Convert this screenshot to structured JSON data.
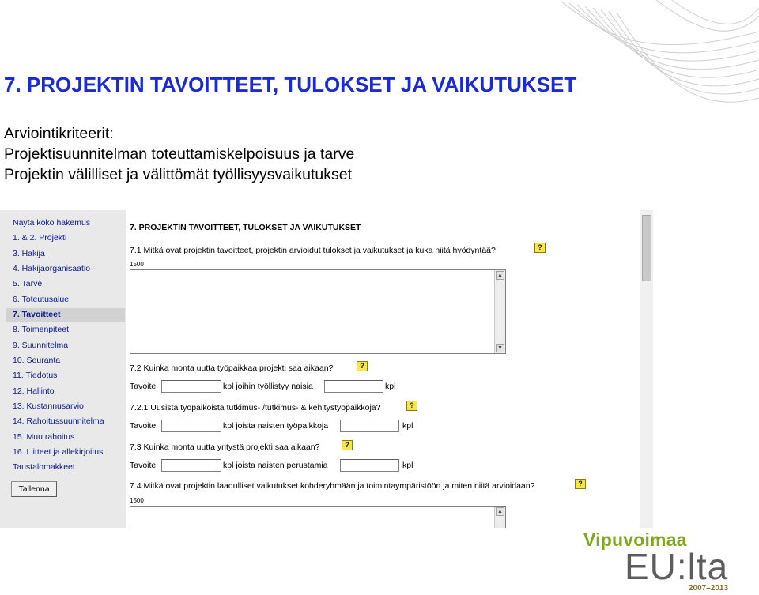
{
  "slide": {
    "title": "7. PROJEKTIN TAVOITTEET, TULOKSET JA VAIKUTUKSET",
    "criteria_heading": "Arviointikriteerit:",
    "criteria": [
      "Projektisuunnitelman toteuttamiskelpoisuus ja tarve",
      "Projektin välilliset ja välittömät työllisyysvaikutukset"
    ]
  },
  "sidebar": {
    "items": [
      "Näytä koko hakemus",
      "1. & 2. Projekti",
      "3. Hakija",
      "4. Hakijaorganisaatio",
      "5. Tarve",
      "6. Toteutusalue",
      "7. Tavoitteet",
      "8. Toimenpiteet",
      "9. Suunnitelma",
      "10. Seuranta",
      "11. Tiedotus",
      "12. Hallinto",
      "13. Kustannusarvio",
      "14. Rahoitussuunnitelma",
      "15. Muu rahoitus",
      "16. Liitteet ja allekirjoitus",
      "Taustalomakkeet"
    ],
    "active_index": 6,
    "save_label": "Tallenna"
  },
  "form": {
    "title": "7. PROJEKTIN TAVOITTEET, TULOKSET JA VAIKUTUKSET",
    "help_glyph": "?",
    "q71": {
      "label": "7.1 Mitkä ovat projektin tavoitteet, projektin arvioidut tulokset ja vaikutukset ja kuka niitä hyödyntää?",
      "limit": "1500"
    },
    "q72": {
      "label": "7.2 Kuinka monta uutta työpaikkaa projekti saa aikaan?",
      "goal": "Tavoite",
      "mid": "kpl joihin työllistyy naisia",
      "unit": "kpl"
    },
    "q721": {
      "label": "7.2.1 Uusista työpaikoista tutkimus- /tutkimus- & kehitystyöpaikkoja?",
      "goal": "Tavoite",
      "mid": "kpl joista naisten työpaikkoja",
      "unit": "kpl"
    },
    "q73": {
      "label": "7.3 Kuinka monta uutta yritystä projekti saa aikaan?",
      "goal": "Tavoite",
      "mid": "kpl joista naisten perustamia",
      "unit": "kpl"
    },
    "q74": {
      "label": "7.4 Mitkä ovat projektin laadulliset vaikutukset kohderyhmään ja toimintaympäristöön ja miten niitä arvioidaan?",
      "limit": "1500"
    }
  },
  "logo": {
    "brand": "Vipuvoimaa",
    "brand_sub": "EU:lta",
    "years": "2007–2013"
  },
  "colors": {
    "title_blue": "#1a2bd6",
    "nav_link": "#0b1a8f",
    "help_yellow": "#f6e64a",
    "logo_green": "#7fa81d",
    "logo_gray": "#5d5d5d"
  }
}
